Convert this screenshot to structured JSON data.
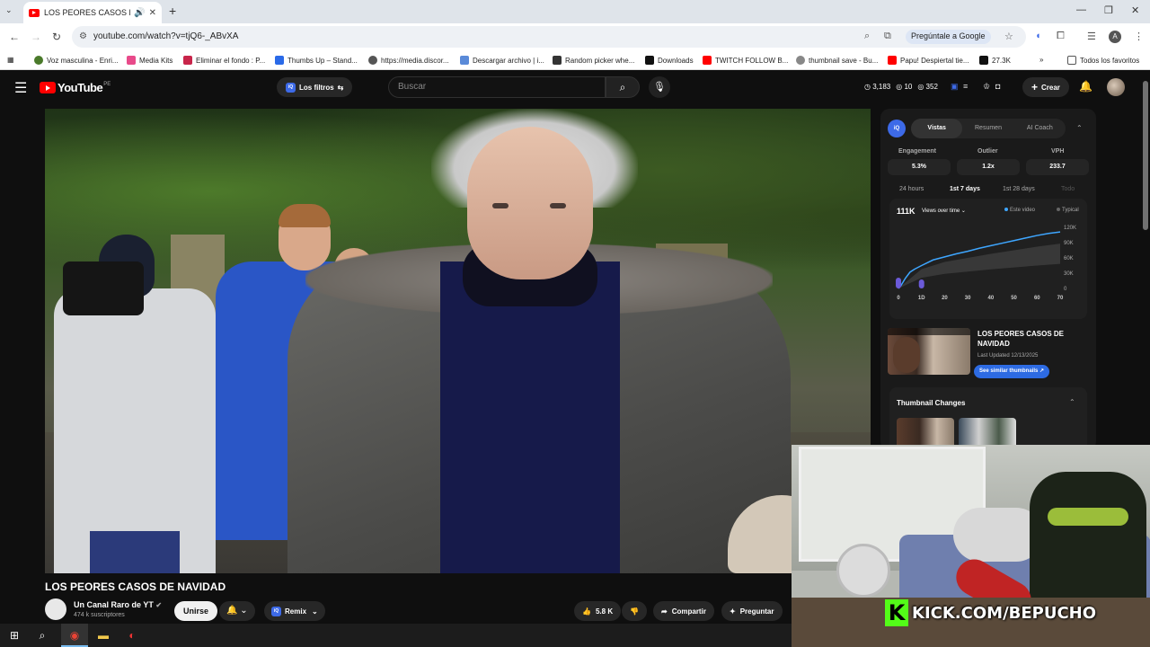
{
  "browser": {
    "tab_title": "LOS PEORES CASOS DE NA",
    "url": "youtube.com/watch?v=tjQ6-_ABvXA",
    "ask_google": "Pregúntale a Google",
    "profile_letter": "A",
    "bookmarks": [
      "Voz masculina - Enri...",
      "Media Kits",
      "Eliminar el fondo : P...",
      "Thumbs Up – Stand...",
      "https://media.discor...",
      "Descargar archivo | i...",
      "Random picker whe...",
      "Downloads",
      "TWITCH FOLLOW B...",
      "thumbnail save - Bu...",
      "Papu! Despiertal tie...",
      "27.3K"
    ],
    "all_favorites": "Todos los favoritos"
  },
  "youtube": {
    "logo_text": "YouTube",
    "country_code": "PE",
    "filters_label": "Los filtros",
    "search_placeholder": "Buscar",
    "stats": [
      "3,183",
      "10",
      "352"
    ],
    "create_label": "Crear"
  },
  "video": {
    "title": "LOS PEORES CASOS DE NAVIDAD",
    "channel_name": "Un Canal Raro de YT",
    "subscribers": "474 k suscriptores",
    "join_label": "Unirse",
    "remix_label": "Remix",
    "likes": "5.8 K",
    "share_label": "Compartir",
    "ask_label": "Preguntar"
  },
  "sidebar": {
    "tabs": [
      "Vistas",
      "Resumen",
      "AI Coach"
    ],
    "metrics": [
      {
        "label": "Engagement",
        "value": "5.3%"
      },
      {
        "label": "Outlier",
        "value": "1.2x"
      },
      {
        "label": "VPH",
        "value": "233.7"
      }
    ],
    "periods": [
      "24 hours",
      "1st 7 days",
      "1st 28 days",
      "Todo"
    ],
    "active_period": "1st 7 days",
    "chart_views": "111K",
    "chart_dropdown": "Views over time",
    "legend_this": "Este video",
    "legend_typical": "Typical",
    "similar_title": "LOS PEORES CASOS DE NAVIDAD",
    "last_updated": "Last Updated 12/13/2025",
    "similar_button": "See similar thumbnails",
    "thumbnail_changes": "Thumbnail Changes",
    "accent_color": "#3ea6ff"
  },
  "chart_data": {
    "type": "line",
    "x_tick_labels": [
      "0",
      "1D",
      "20",
      "30",
      "40",
      "50",
      "60",
      "70"
    ],
    "y_tick_labels": [
      "120K",
      "90K",
      "60K",
      "30K",
      "0"
    ],
    "ylim": [
      0,
      120000
    ],
    "series": [
      {
        "name": "Este video",
        "x": [
          0,
          1,
          3,
          5,
          7,
          10,
          15,
          20,
          25,
          30,
          35,
          40,
          45,
          50,
          55,
          60,
          65,
          70
        ],
        "values": [
          0,
          5000,
          20000,
          32000,
          38000,
          45000,
          56000,
          62000,
          68000,
          73000,
          79000,
          84000,
          89000,
          94000,
          99000,
          104000,
          108000,
          111000
        ]
      },
      {
        "name": "Typical",
        "x": [
          0,
          10,
          20,
          30,
          40,
          50,
          60,
          70
        ],
        "values": [
          0,
          38000,
          52000,
          60000,
          68000,
          75000,
          82000,
          88000
        ]
      }
    ]
  },
  "overlay": {
    "kick_text": "KICK.COM/BEPUCHO",
    "kick_letter": "K"
  }
}
